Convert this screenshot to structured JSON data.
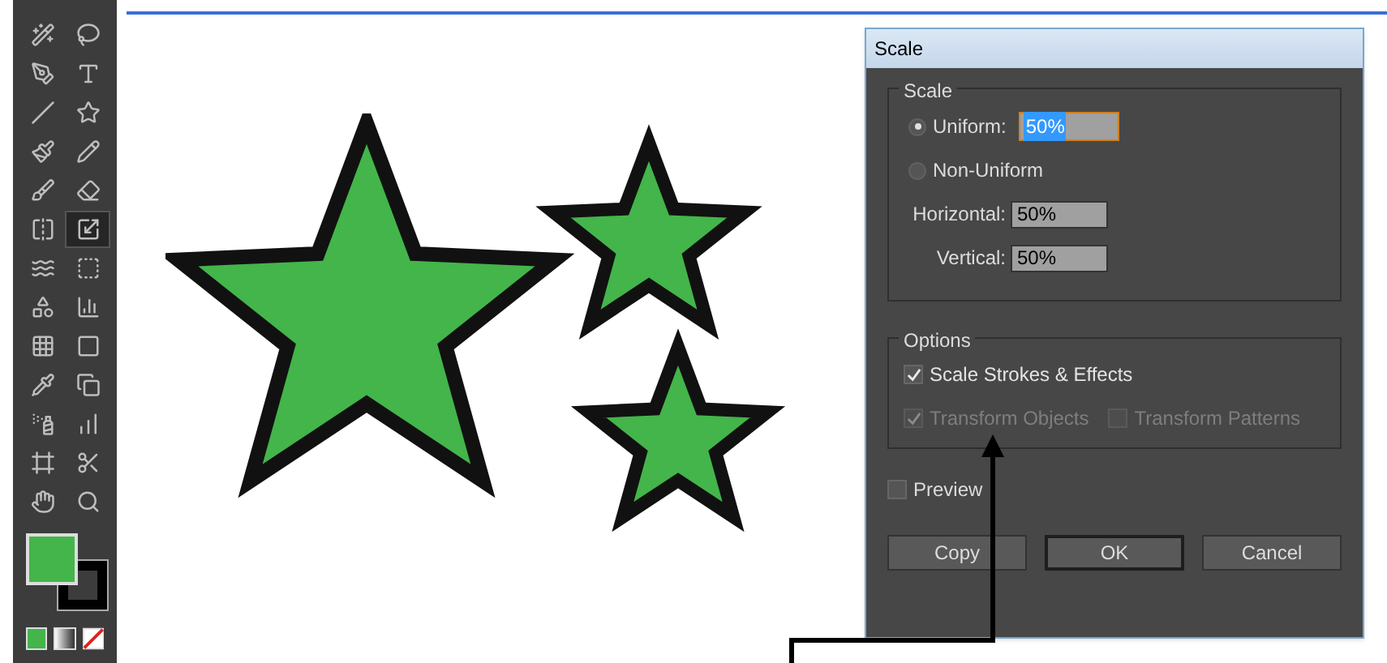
{
  "tools": [
    {
      "selected": false
    },
    {
      "selected": false
    },
    {
      "selected": false
    },
    {
      "selected": false
    },
    {
      "selected": false
    },
    {
      "selected": false
    },
    {
      "selected": false
    },
    {
      "selected": false
    },
    {
      "selected": false
    },
    {
      "selected": false
    },
    {
      "selected": false
    },
    {
      "selected": true
    },
    {
      "selected": false
    },
    {
      "selected": false
    },
    {
      "selected": false
    },
    {
      "selected": false
    },
    {
      "selected": false
    },
    {
      "selected": false
    },
    {
      "selected": false
    },
    {
      "selected": false
    },
    {
      "selected": false
    },
    {
      "selected": false
    },
    {
      "selected": false
    },
    {
      "selected": false
    },
    {
      "selected": false
    },
    {
      "selected": false
    }
  ],
  "dialog": {
    "title": "Scale",
    "scale_group": {
      "legend": "Scale",
      "radios": [
        {
          "label": "Uniform:",
          "selected": true,
          "value": "50%"
        },
        {
          "label": "Non-Uniform",
          "selected": false
        }
      ],
      "fields": [
        {
          "label": "Horizontal:",
          "value": "50%"
        },
        {
          "label": "Vertical:",
          "value": "50%"
        }
      ]
    },
    "options_group": {
      "legend": "Options",
      "checkboxes": [
        {
          "label": "Scale Strokes & Effects",
          "checked": true,
          "disabled": false
        },
        {
          "label": "Transform Objects",
          "checked": true,
          "disabled": true
        },
        {
          "label": "Transform Patterns",
          "checked": false,
          "disabled": true
        }
      ]
    },
    "preview": {
      "label": "Preview",
      "checked": false
    },
    "buttons": [
      {
        "label": "Copy",
        "default": false
      },
      {
        "label": "OK",
        "default": true
      },
      {
        "label": "Cancel",
        "default": false
      }
    ]
  }
}
